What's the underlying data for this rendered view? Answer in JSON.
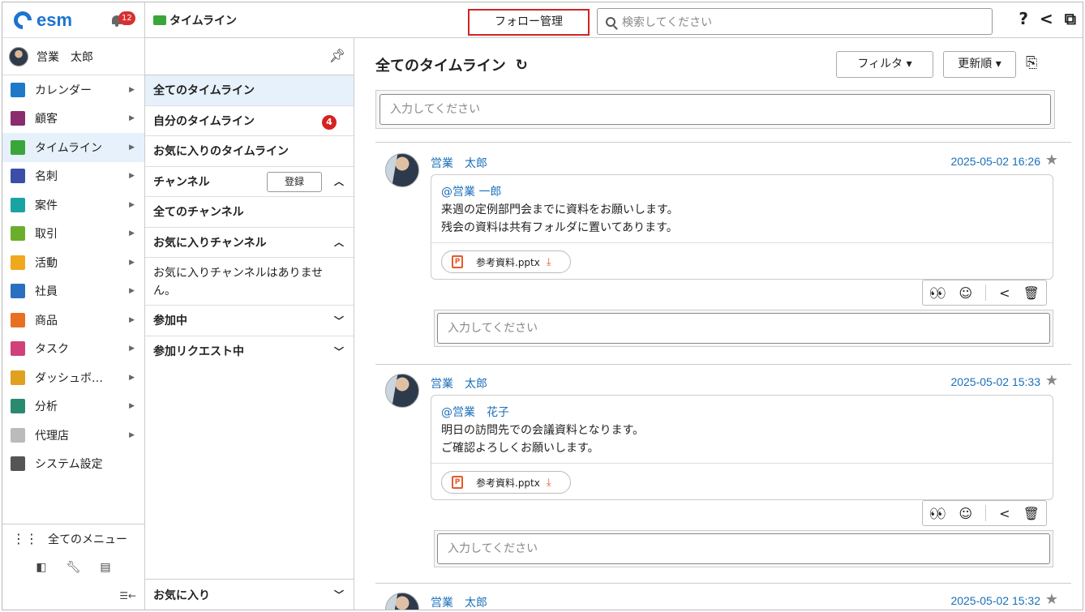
{
  "app": {
    "logo": "esm",
    "notification_count": "12",
    "user_name": "営業　太郎"
  },
  "menu": [
    {
      "label": "カレンダー",
      "icon": "calendar-icon",
      "color": "#1f78c8",
      "active": false
    },
    {
      "label": "顧客",
      "icon": "building-icon",
      "color": "#8a2c6e",
      "active": false
    },
    {
      "label": "タイムライン",
      "icon": "chat-icon",
      "color": "#3aa53a",
      "active": true
    },
    {
      "label": "名刺",
      "icon": "card-icon",
      "color": "#3b4fa8",
      "active": false
    },
    {
      "label": "案件",
      "icon": "folder-icon",
      "color": "#1aa3a3",
      "active": false
    },
    {
      "label": "取引",
      "icon": "ledger-icon",
      "color": "#6cae2b",
      "active": false
    },
    {
      "label": "活動",
      "icon": "clipboard-icon",
      "color": "#f0a81e",
      "active": false
    },
    {
      "label": "社員",
      "icon": "person-icon",
      "color": "#2a6fc0",
      "active": false
    },
    {
      "label": "商品",
      "icon": "box-icon",
      "color": "#e87020",
      "active": false
    },
    {
      "label": "タスク",
      "icon": "check-icon",
      "color": "#d0407a",
      "active": false
    },
    {
      "label": "ダッシュボ…",
      "icon": "dashboard-icon",
      "color": "#e0a020",
      "active": false
    },
    {
      "label": "分析",
      "icon": "chart-icon",
      "color": "#2a8a70",
      "active": false
    },
    {
      "label": "代理店",
      "icon": "document-icon",
      "color": "#bbbbbb",
      "active": false
    },
    {
      "label": "システム設定",
      "icon": "gear-icon",
      "color": "#555555",
      "active": false
    }
  ],
  "sidebar_bottom": {
    "all_menu": "全てのメニュー"
  },
  "header": {
    "section_title": "タイムライン",
    "follow_button": "フォロー管理",
    "search_placeholder": "検索してください"
  },
  "midcol": {
    "all_timeline": "全てのタイムライン",
    "my_timeline": "自分のタイムライン",
    "my_timeline_badge": "4",
    "fav_timeline": "お気に入りのタイムライン",
    "channel": "チャンネル",
    "register": "登録",
    "all_channels": "全てのチャンネル",
    "fav_channels": "お気に入りチャンネル",
    "fav_channels_empty": "お気に入りチャンネルはありません。",
    "joined": "参加中",
    "join_request": "参加リクエスト中",
    "favorites": "お気に入り"
  },
  "main": {
    "title": "全てのタイムライン",
    "filter": "フィルタ",
    "sort": "更新順",
    "input_placeholder": "入力してください"
  },
  "posts": [
    {
      "author": "営業　太郎",
      "time": "2025-05-02 16:26",
      "mention": "@営業 一郎",
      "line1": "来週の定例部門会までに資料をお願いします。",
      "line2": "残会の資料は共有フォルダに置いてあります。",
      "attachment": "参考資料.pptx",
      "reply_placeholder": "入力してください"
    },
    {
      "author": "営業　太郎",
      "time": "2025-05-02 15:33",
      "mention": "@営業　花子",
      "line1": "明日の訪問先での会議資料となります。",
      "line2": "ご確認よろしくお願いします。",
      "attachment": "参考資料.pptx",
      "reply_placeholder": "入力してください"
    },
    {
      "author": "営業　太郎",
      "time": "2025-05-02 15:32"
    }
  ]
}
